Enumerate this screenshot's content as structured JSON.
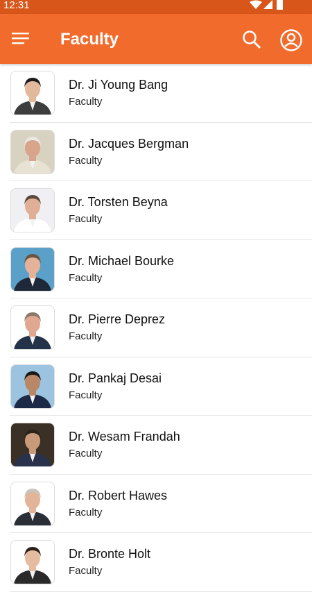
{
  "status_bar": {
    "time": "12:31",
    "icons": [
      "wifi-icon",
      "signal-icon",
      "battery-icon"
    ]
  },
  "app_bar": {
    "title": "Faculty",
    "background": "#f16b2c",
    "icons": [
      "menu-icon",
      "search-icon",
      "account-icon"
    ]
  },
  "faculty": [
    {
      "name": "Dr. Ji Young Bang",
      "role": "Faculty",
      "photo_bg": "#ffffff",
      "suit": "#3d3d3d",
      "hair": "#1b1b1b",
      "skin": "#e3b99b"
    },
    {
      "name": "Dr. Jacques Bergman",
      "role": "Faculty",
      "photo_bg": "#d8d2c0",
      "suit": "#e7e2d2",
      "hair": "#e8e8e4",
      "skin": "#d8a48c"
    },
    {
      "name": "Dr. Torsten Beyna",
      "role": "Faculty",
      "photo_bg": "#f0f0f4",
      "suit": "#ffffff",
      "hair": "#5a4a3c",
      "skin": "#e0b096"
    },
    {
      "name": "Dr. Michael Bourke",
      "role": "Faculty",
      "photo_bg": "#5aa0c8",
      "suit": "#1e2838",
      "hair": "#6a5540",
      "skin": "#e4b298"
    },
    {
      "name": "Dr. Pierre Deprez",
      "role": "Faculty",
      "photo_bg": "#ffffff",
      "suit": "#24324a",
      "hair": "#8a7868",
      "skin": "#e0a890"
    },
    {
      "name": "Dr. Pankaj Desai",
      "role": "Faculty",
      "photo_bg": "#9cc4e0",
      "suit": "#1c2a48",
      "hair": "#1a1a1a",
      "skin": "#b98766"
    },
    {
      "name": "Dr. Wesam Frandah",
      "role": "Faculty",
      "photo_bg": "#3b3026",
      "suit": "#28324a",
      "hair": "#2a221c",
      "skin": "#c99a7a"
    },
    {
      "name": "Dr. Robert Hawes",
      "role": "Faculty",
      "photo_bg": "#ffffff",
      "suit": "#2a2e36",
      "hair": "#c8c4bc",
      "skin": "#e2b49a"
    },
    {
      "name": "Dr. Bronte Holt",
      "role": "Faculty",
      "photo_bg": "#ffffff",
      "suit": "#2a2a2a",
      "hair": "#2a2018",
      "skin": "#e6bca0"
    }
  ]
}
